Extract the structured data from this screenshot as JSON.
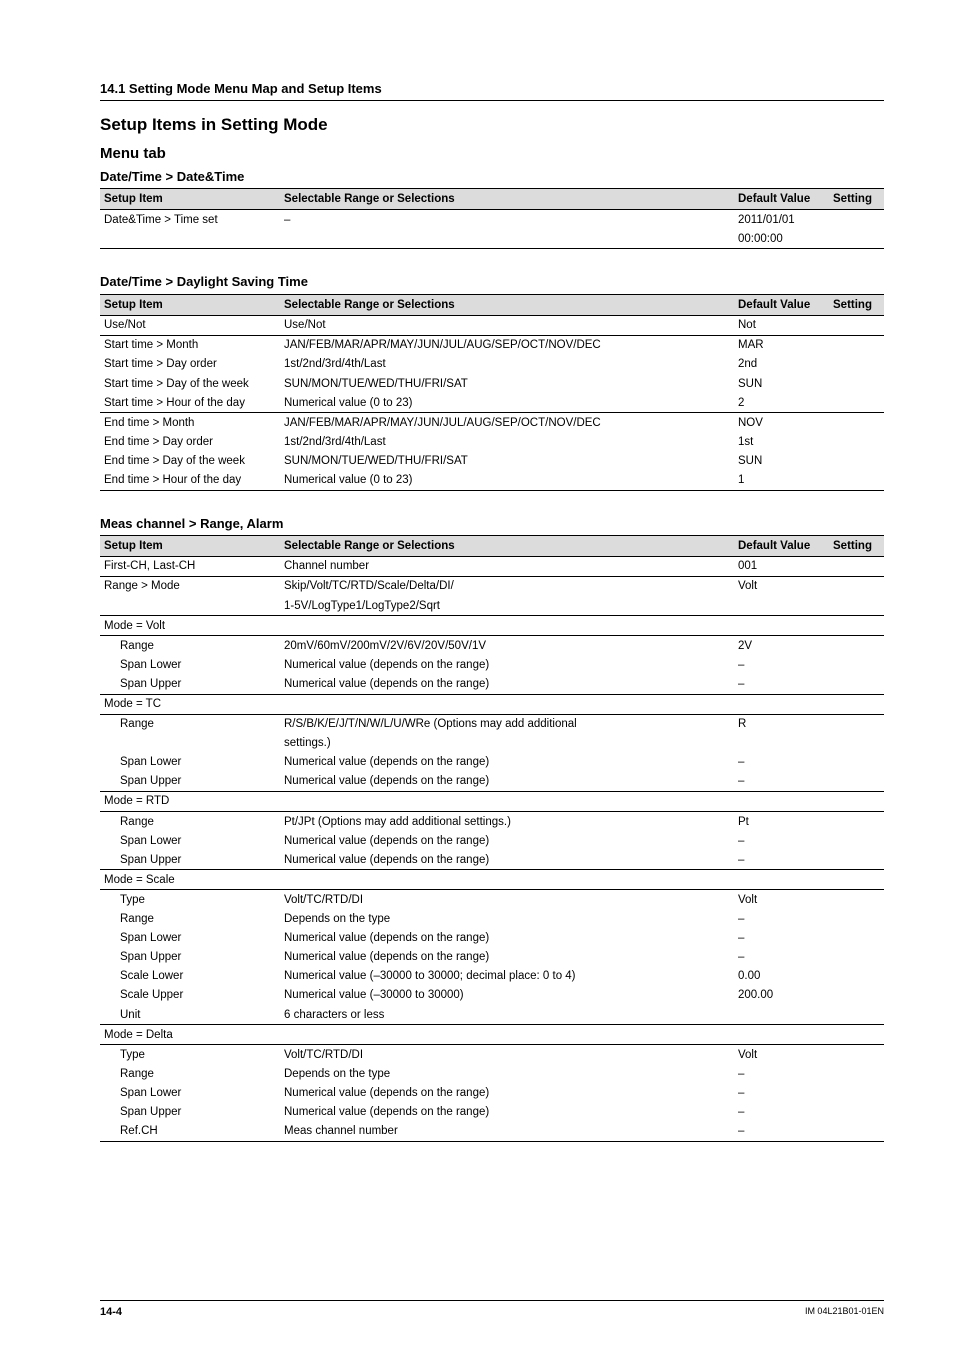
{
  "breadcrumb": "14.1  Setting Mode Menu Map and Setup Items",
  "section_title": "Setup Items in Setting Mode",
  "sub_title": "Menu tab",
  "header": {
    "c1": "Setup Item",
    "c2": "Selectable Range or Selections",
    "c3": "Default Value",
    "c4": "Setting"
  },
  "group_datetime_datetime": {
    "title": "Date/Time > Date&Time",
    "rows": [
      {
        "c1": "Date&Time > Time set",
        "c2": "–",
        "c3": "2011/01/01",
        "suppress_border": true
      },
      {
        "c1": "",
        "c2": "",
        "c3": "00:00:00",
        "line_after": true
      }
    ]
  },
  "group_datetime_dst": {
    "title": "Date/Time > Daylight Saving Time",
    "rows": [
      {
        "c1": "Use/Not",
        "c2": "Use/Not",
        "c3": "Not",
        "line_after": true
      },
      {
        "c1": "Start time > Month",
        "c2": "JAN/FEB/MAR/APR/MAY/JUN/JUL/AUG/SEP/OCT/NOV/DEC",
        "c3": "MAR"
      },
      {
        "c1": "Start time > Day order",
        "c2": "1st/2nd/3rd/4th/Last",
        "c3": "2nd"
      },
      {
        "c1": "Start time > Day of the week",
        "c2": "SUN/MON/TUE/WED/THU/FRI/SAT",
        "c3": "SUN"
      },
      {
        "c1": "Start time > Hour of the day",
        "c2": "Numerical value (0 to 23)",
        "c3": "2",
        "line_after": true
      },
      {
        "c1": "End time > Month",
        "c2": "JAN/FEB/MAR/APR/MAY/JUN/JUL/AUG/SEP/OCT/NOV/DEC",
        "c3": "NOV"
      },
      {
        "c1": "End time > Day order",
        "c2": "1st/2nd/3rd/4th/Last",
        "c3": "1st"
      },
      {
        "c1": "End time > Day of the week",
        "c2": "SUN/MON/TUE/WED/THU/FRI/SAT",
        "c3": "SUN"
      },
      {
        "c1": "End time > Hour of the day",
        "c2": "Numerical value (0 to 23)",
        "c3": "1",
        "line_after": true
      }
    ]
  },
  "group_meas_range_alarm": {
    "title": "Meas channel > Range, Alarm",
    "rows": [
      {
        "c1": "First-CH, Last-CH",
        "c2": "Channel number",
        "c3": "001",
        "line_after": true
      },
      {
        "c1": "Range > Mode",
        "c2": "Skip/Volt/TC/RTD/Scale/Delta/DI/",
        "c3": "Volt"
      },
      {
        "c1": "",
        "c2": "1-5V/LogType1/LogType2/Sqrt",
        "c3": "",
        "line_after": true
      },
      {
        "c1": "Mode = Volt",
        "c2": "",
        "c3": "",
        "line_after": true
      },
      {
        "c1": "Range",
        "indent": 1,
        "c2": "20mV/60mV/200mV/2V/6V/20V/50V/1V",
        "c3": "2V"
      },
      {
        "c1": "Span Lower",
        "indent": 1,
        "c2": "Numerical value (depends on the range)",
        "c3": "–"
      },
      {
        "c1": "Span Upper",
        "indent": 1,
        "c2": "Numerical value (depends on the range)",
        "c3": "–",
        "line_after": true
      },
      {
        "c1": "Mode = TC",
        "c2": "",
        "c3": "",
        "line_after": true
      },
      {
        "c1": "Range",
        "indent": 1,
        "c2": "R/S/B/K/E/J/T/N/W/L/U/WRe (Options may add additional",
        "c3": "R"
      },
      {
        "c1": "",
        "c2": "settings.)",
        "c3": ""
      },
      {
        "c1": "Span Lower",
        "indent": 1,
        "c2": "Numerical value (depends on the range)",
        "c3": "–"
      },
      {
        "c1": "Span Upper",
        "indent": 1,
        "c2": "Numerical value (depends on the range)",
        "c3": "–",
        "line_after": true
      },
      {
        "c1": "Mode = RTD",
        "c2": "",
        "c3": "",
        "line_after": true
      },
      {
        "c1": "Range",
        "indent": 1,
        "c2": "Pt/JPt (Options may add additional settings.)",
        "c3": "Pt"
      },
      {
        "c1": "Span Lower",
        "indent": 1,
        "c2": "Numerical value (depends on the range)",
        "c3": "–"
      },
      {
        "c1": "Span Upper",
        "indent": 1,
        "c2": "Numerical value (depends on the range)",
        "c3": "–",
        "line_after": true
      },
      {
        "c1": "Mode = Scale",
        "c2": "",
        "c3": "",
        "line_after": true
      },
      {
        "c1": "Type",
        "indent": 1,
        "c2": "Volt/TC/RTD/DI",
        "c3": "Volt"
      },
      {
        "c1": "Range",
        "indent": 1,
        "c2": "Depends on the type",
        "c3": "–"
      },
      {
        "c1": "Span Lower",
        "indent": 1,
        "c2": "Numerical value (depends on the range)",
        "c3": "–"
      },
      {
        "c1": "Span Upper",
        "indent": 1,
        "c2": "Numerical value (depends on the range)",
        "c3": "–"
      },
      {
        "c1": "Scale Lower",
        "indent": 1,
        "c2": "Numerical value (–30000 to 30000; decimal place: 0 to 4)",
        "c3": "0.00"
      },
      {
        "c1": "Scale Upper",
        "indent": 1,
        "c2": "Numerical value (–30000 to 30000)",
        "c3": "200.00"
      },
      {
        "c1": "Unit",
        "indent": 1,
        "c2": "6 characters or less",
        "c3": "",
        "line_after": true
      },
      {
        "c1": "Mode = Delta",
        "c2": "",
        "c3": "",
        "line_after": true
      },
      {
        "c1": "Type",
        "indent": 1,
        "c2": "Volt/TC/RTD/DI",
        "c3": "Volt"
      },
      {
        "c1": "Range",
        "indent": 1,
        "c2": "Depends on the type",
        "c3": "–"
      },
      {
        "c1": "Span Lower",
        "indent": 1,
        "c2": "Numerical value (depends on the range)",
        "c3": "–"
      },
      {
        "c1": "Span Upper",
        "indent": 1,
        "c2": "Numerical value (depends on the range)",
        "c3": "–"
      },
      {
        "c1": "Ref.CH",
        "indent": 1,
        "c2": "Meas channel number",
        "c3": "–",
        "line_after": true
      }
    ]
  },
  "footer": {
    "page": "14-4",
    "doc": "IM 04L21B01-01EN"
  }
}
